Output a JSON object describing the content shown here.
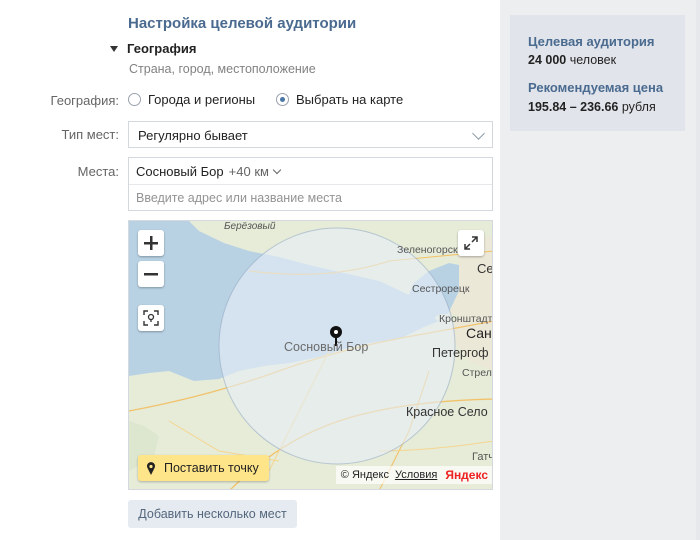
{
  "section_title": "Настройка целевой аудитории",
  "geography": {
    "heading": "География",
    "subtitle": "Страна, город, местоположение",
    "label": "География:",
    "options": [
      "Города и регионы",
      "Выбрать на карте"
    ],
    "selected": "Выбрать на карте"
  },
  "place_type": {
    "label": "Тип мест:",
    "value": "Регулярно бывает"
  },
  "places": {
    "label": "Места:",
    "chip_name": "Сосновый Бор",
    "chip_radius": "+40 км",
    "placeholder": "Введите адрес или название места"
  },
  "map": {
    "labels": {
      "berezovy": "Берёзовый",
      "zelenogorsk": "Зеленогорск",
      "sestroretsk": "Сестрорецк",
      "kronshtadt": "Кронштадт",
      "sosnovy_bor": "Сосновый Бор",
      "peterhof": "Петергоф",
      "strelna": "Стрельна",
      "krasnoe_selo": "Красное Село",
      "gatchina": "Гатч",
      "s": "Се",
      "san": "Сан"
    },
    "place_point_button": "Поставить точку",
    "copyright": "© Яндекс",
    "terms": "Условия",
    "logo": "Яндекс"
  },
  "add_places_button": "Добавить несколько мест",
  "sidebar": {
    "audience_title": "Целевая аудитория",
    "audience_value": "24 000",
    "audience_unit": "человек",
    "price_title": "Рекомендуемая цена",
    "price_value": "195.84 – 236.66",
    "price_unit": "рубля"
  },
  "colors": {
    "accent": "#4a76a8",
    "title": "#4a6a8f",
    "button_yellow": "#ffe58a",
    "water": "#b8d2e4",
    "land": "#e6ecd8"
  }
}
